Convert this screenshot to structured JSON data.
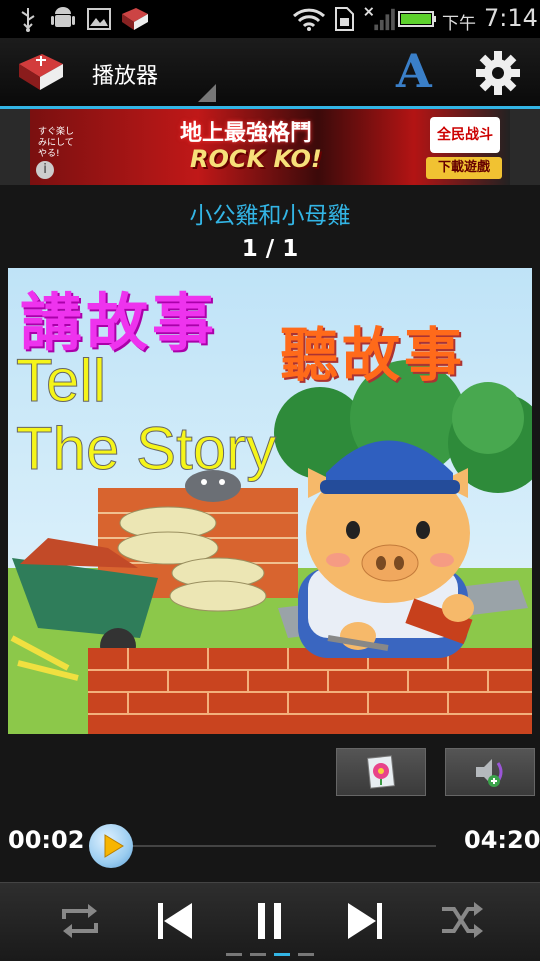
{
  "status_bar": {
    "ampm": "下午",
    "time": "7:14"
  },
  "action_bar": {
    "title": "播放器",
    "font_button_glyph": "A",
    "settings_icon": "gear-icon"
  },
  "ad": {
    "small_text": "すぐ楽しみにしてやる!",
    "headline": "地上最強格鬥",
    "tagline": "ROCK KO!",
    "logo_text": "全民战斗",
    "download_label": "下載遊戲",
    "info_glyph": "i"
  },
  "story": {
    "title": "小公雞和小母雞",
    "page_indicator": "1 / 1"
  },
  "cover": {
    "chinese_left": "講故事",
    "chinese_right": "聽故事",
    "english_line1": "Tell",
    "english_line2": "The Story"
  },
  "player": {
    "elapsed": "00:02",
    "duration": "04:20",
    "progress_fraction": 0.008
  },
  "controls": {
    "repeat_icon": "repeat-icon",
    "previous_icon": "skip-previous-icon",
    "pause_icon": "pause-icon",
    "next_icon": "skip-next-icon",
    "shuffle_icon": "shuffle-icon"
  },
  "colors": {
    "accent": "#33b5e5",
    "background": "#161616"
  }
}
